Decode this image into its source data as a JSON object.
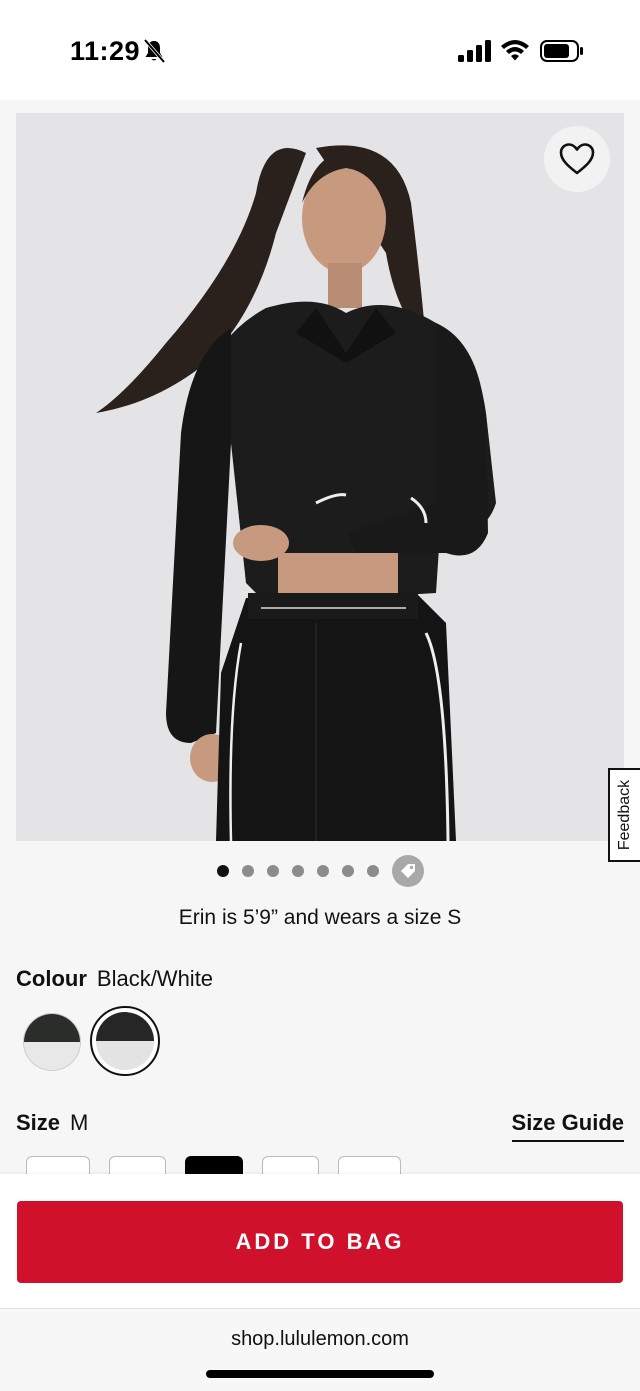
{
  "status_bar": {
    "time": "11:29"
  },
  "product": {
    "model_info": "Erin is 5’9” and wears a size S",
    "gallery": {
      "total_images": 8,
      "active_index": 0
    }
  },
  "feedback": {
    "label": "Feedback"
  },
  "colour": {
    "label": "Colour",
    "value": "Black/White",
    "swatch_colors": [
      "#2b2d2a",
      "#e8e8e8"
    ]
  },
  "size": {
    "label": "Size",
    "value": "M",
    "guide_label": "Size Guide"
  },
  "actions": {
    "add_to_bag": "ADD TO BAG"
  },
  "browser": {
    "url": "shop.lululemon.com"
  },
  "colors": {
    "accent": "#d0112b"
  }
}
